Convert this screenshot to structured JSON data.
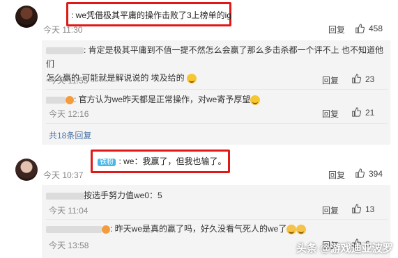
{
  "comment1": {
    "text": ": we凭借极其平庸的操作击败了3上榜单的ig",
    "time": "今天 11:30",
    "reply": "回复",
    "likes": "458"
  },
  "sub1": {
    "reply_a": {
      "text_line1": ": 肯定是极其平庸到不值一提不然怎么会赢了那么多击杀都一个评不上 也不知道他们",
      "text_line2": "怎么赢的 可能就是解说说的 埃及给的",
      "time": "今天 11:55",
      "reply": "回复",
      "likes": "23"
    },
    "reply_b": {
      "text": ": 官方认为we昨天都是正常操作，对we寄予厚望",
      "time": "今天 12:16",
      "reply": "回复",
      "likes": "21"
    },
    "more": "共18条回复"
  },
  "comment2": {
    "badge": "铁粉",
    "text": ": we：我赢了，但我也输了。",
    "time": "今天 10:37",
    "reply": "回复",
    "likes": "394"
  },
  "sub2": {
    "reply_a": {
      "text": "按选手努力值we0：5",
      "time": "今天 11:04",
      "reply": "回复",
      "likes": "13"
    },
    "reply_b": {
      "text": ": 昨天we是真的赢了吗，好久没看气死人的we了",
      "time": "今天 13:58",
      "reply": "回复",
      "likes": "6"
    }
  },
  "watermark": "头条 @游戏迪亚波罗",
  "icons": {
    "like": "thumbs-up-icon"
  }
}
